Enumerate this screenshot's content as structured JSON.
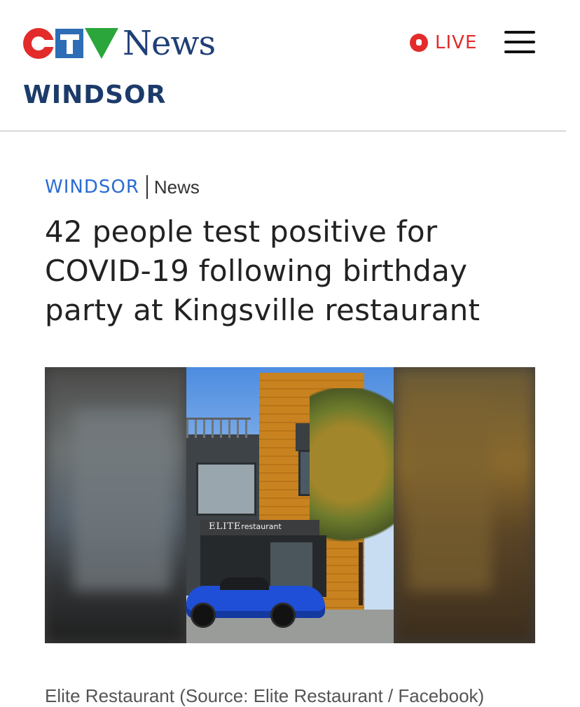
{
  "header": {
    "logo_text": "CTV News",
    "region": "WINDSOR",
    "live_label": "LIVE"
  },
  "article": {
    "section_region": "WINDSOR",
    "section_category": "News",
    "headline": "42 people test positive for COVID-19 following birthday party at Kingsville restaurant",
    "image": {
      "sign_text_main": "ELITE",
      "sign_text_sub": "restaurant"
    },
    "caption": "Elite Restaurant (Source: Elite Restaurant / Facebook)"
  },
  "colors": {
    "brand_red": "#e32b2b",
    "brand_blue": "#2d6db5",
    "brand_green": "#2aa63a",
    "region_navy": "#1c3b6a",
    "section_blue": "#2b6cd4"
  },
  "icons": [
    "live-icon",
    "hamburger-menu-icon"
  ]
}
